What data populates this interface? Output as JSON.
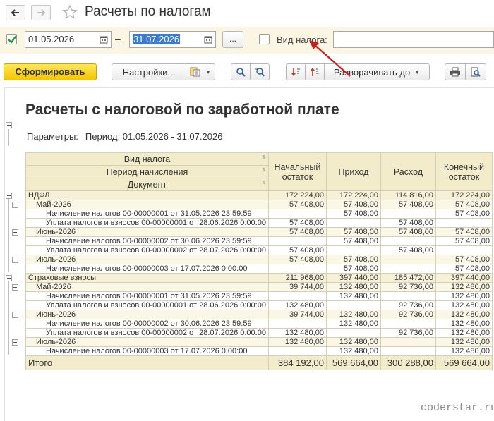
{
  "window": {
    "title": "Расчеты по налогам"
  },
  "filters": {
    "period_enabled": true,
    "date_from": "01.05.2026",
    "date_separator": "–",
    "date_to": "31.07.2026",
    "more_button": "...",
    "tax_type_enabled": false,
    "tax_type_label": "Вид налога:",
    "tax_type_value": ""
  },
  "toolbar": {
    "generate": "Сформировать",
    "settings": "Настройки...",
    "expand_to": "Разворачивать до"
  },
  "report": {
    "title": "Расчеты с налоговой по заработной плате",
    "params_label": "Параметры:",
    "params_value": "Период: 01.05.2026 - 31.07.2026",
    "headers": {
      "group1": "Вид налога",
      "group2": "Период начисления",
      "group3": "Документ",
      "opening": "Начальный остаток",
      "income": "Приход",
      "expense": "Расход",
      "closing": "Конечный остаток"
    },
    "rows": [
      {
        "level": 0,
        "name": "НДФЛ",
        "opening": "172 224,00",
        "income": "172 224,00",
        "expense": "114 816,00",
        "closing": "172 224,00"
      },
      {
        "level": 1,
        "name": "Май-2026",
        "opening": "57 408,00",
        "income": "57 408,00",
        "expense": "57 408,00",
        "closing": "57 408,00"
      },
      {
        "level": 2,
        "name": "Начисление налогов 00-00000001 от 31.05.2026 23:59:59",
        "opening": "",
        "income": "57 408,00",
        "expense": "",
        "closing": "57 408,00"
      },
      {
        "level": 2,
        "name": "Уплата налогов и взносов 00-00000001 от 28.06.2026 0:00:00",
        "opening": "57 408,00",
        "income": "",
        "expense": "57 408,00",
        "closing": ""
      },
      {
        "level": 1,
        "name": "Июнь-2026",
        "opening": "57 408,00",
        "income": "57 408,00",
        "expense": "57 408,00",
        "closing": "57 408,00"
      },
      {
        "level": 2,
        "name": "Начисление налогов 00-00000002 от 30.06.2026 23:59:59",
        "opening": "",
        "income": "57 408,00",
        "expense": "",
        "closing": "57 408,00"
      },
      {
        "level": 2,
        "name": "Уплата налогов и взносов 00-00000002 от 28.07.2026 0:00:00",
        "opening": "57 408,00",
        "income": "",
        "expense": "57 408,00",
        "closing": ""
      },
      {
        "level": 1,
        "name": "Июль-2026",
        "opening": "57 408,00",
        "income": "57 408,00",
        "expense": "",
        "closing": "57 408,00"
      },
      {
        "level": 2,
        "name": "Начисление налогов 00-00000003 от 17.07.2026 0:00:00",
        "opening": "",
        "income": "57 408,00",
        "expense": "",
        "closing": "57 408,00"
      },
      {
        "level": 0,
        "name": "Страховые взносы",
        "opening": "211 968,00",
        "income": "397 440,00",
        "expense": "185 472,00",
        "closing": "397 440,00"
      },
      {
        "level": 1,
        "name": "Май-2026",
        "opening": "39 744,00",
        "income": "132 480,00",
        "expense": "92 736,00",
        "closing": "132 480,00"
      },
      {
        "level": 2,
        "name": "Начисление налогов 00-00000001 от 31.05.2026 23:59:59",
        "opening": "",
        "income": "132 480,00",
        "expense": "",
        "closing": "132 480,00"
      },
      {
        "level": 2,
        "name": "Уплата налогов и взносов 00-00000001 от 28.06.2026 0:00:00",
        "opening": "132 480,00",
        "income": "",
        "expense": "92 736,00",
        "closing": "132 480,00"
      },
      {
        "level": 1,
        "name": "Июнь-2026",
        "opening": "39 744,00",
        "income": "132 480,00",
        "expense": "92 736,00",
        "closing": "132 480,00"
      },
      {
        "level": 2,
        "name": "Начисление налогов 00-00000002 от 30.06.2026 23:59:59",
        "opening": "",
        "income": "132 480,00",
        "expense": "",
        "closing": "132 480,00"
      },
      {
        "level": 2,
        "name": "Уплата налогов и взносов 00-00000002 от 28.07.2026 0:00:00",
        "opening": "132 480,00",
        "income": "",
        "expense": "92 736,00",
        "closing": "132 480,00"
      },
      {
        "level": 1,
        "name": "Июль-2026",
        "opening": "132 480,00",
        "income": "132 480,00",
        "expense": "",
        "closing": "132 480,00"
      },
      {
        "level": 2,
        "name": "Начисление налогов 00-00000003 от 17.07.2026 0:00:00",
        "opening": "",
        "income": "132 480,00",
        "expense": "",
        "closing": "132 480,00"
      }
    ],
    "total": {
      "name": "Итого",
      "opening": "384 192,00",
      "income": "569 664,00",
      "expense": "300 288,00",
      "closing": "569 664,00"
    }
  },
  "watermark": "coderstar.ru",
  "colors": {
    "accent_yellow": "#f3c600",
    "header_bg": "#f2eccb",
    "selection": "#3a7bd5",
    "annotation_arrow": "#cc1f1f"
  }
}
